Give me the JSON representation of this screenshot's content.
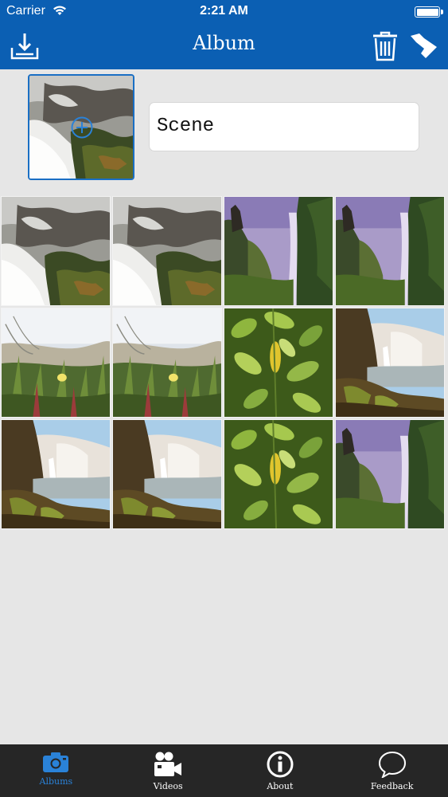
{
  "status_bar": {
    "carrier": "Carrier",
    "time": "2:21 AM"
  },
  "nav": {
    "title": "Album",
    "left_icon": "download-icon",
    "right_icons": [
      "trash-icon",
      "share-arrow-icon"
    ]
  },
  "album": {
    "name": "Scene",
    "cover_icon": "add-circle-icon"
  },
  "photos": [
    "rapids",
    "rapids",
    "cliff-waterfall",
    "cliff-waterfall",
    "grass-flower",
    "grass-flower",
    "leaves",
    "coastal-falls",
    "coastal-falls",
    "coastal-falls",
    "leaves",
    "cliff-waterfall"
  ],
  "tabbar": {
    "active": 0,
    "items": [
      {
        "label": "Albums",
        "icon": "camera-icon"
      },
      {
        "label": "Videos",
        "icon": "video-camera-icon"
      },
      {
        "label": "About",
        "icon": "info-icon"
      },
      {
        "label": "Feedback",
        "icon": "speech-bubble-icon"
      }
    ]
  },
  "colors": {
    "header": "#0b5fb3",
    "accent": "#2a82d8",
    "tabbar": "#262626",
    "background": "#e6e6e6"
  }
}
